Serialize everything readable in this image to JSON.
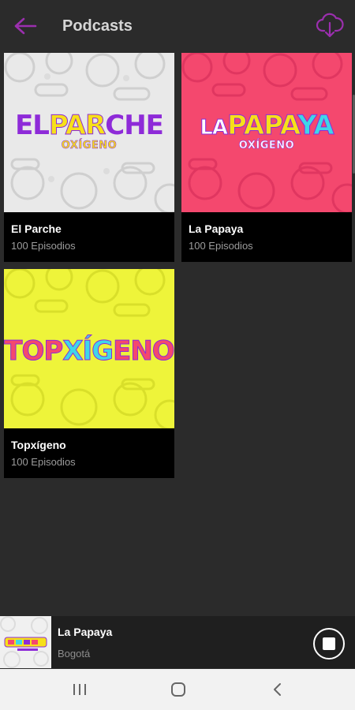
{
  "appbar": {
    "title": "Podcasts",
    "back_icon": "arrow-left-icon",
    "download_icon": "cloud-download-icon",
    "accent_color": "#9b2fae"
  },
  "podcasts": [
    {
      "name": "El Parche",
      "episodes": "100 Episodios",
      "art": {
        "word_a": "EL",
        "word_b": "PAR",
        "word_c": "CHE",
        "sub": "OXÍGENO",
        "background": "#e9e9e9"
      }
    },
    {
      "name": "La Papaya",
      "episodes": "100 Episodios",
      "art": {
        "word_a": "LA",
        "word_b": "PAPA",
        "word_c": "YA",
        "sub": "OXÍGENO",
        "background": "#f4486e"
      }
    },
    {
      "name": "Topxígeno",
      "episodes": "100 Episodios",
      "art": {
        "word_a": "TOP",
        "word_b": "XÍG",
        "word_c": "ENO",
        "sub": "",
        "background": "#eef43a"
      }
    }
  ],
  "player": {
    "title": "La Papaya",
    "subtitle": "Bogotá",
    "stop_icon": "stop-icon"
  },
  "navbar": {
    "recents_icon": "recents-icon",
    "home_icon": "home-icon",
    "back_icon": "nav-back-icon"
  }
}
